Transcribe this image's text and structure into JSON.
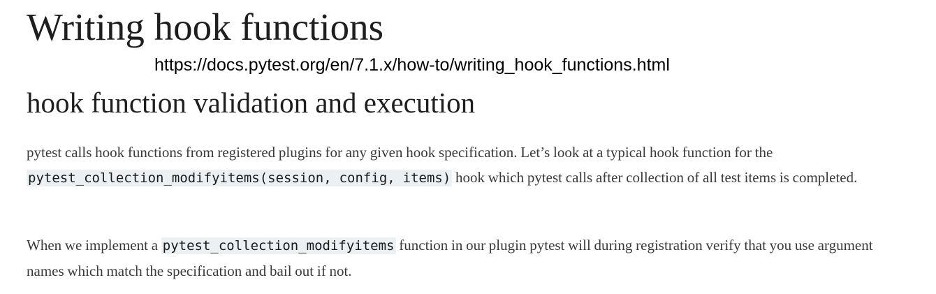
{
  "page": {
    "title": "Writing hook functions",
    "url_annotation": "https://docs.pytest.org/en/7.1.x/how-to/writing_hook_functions.html",
    "section_heading": "hook function validation and execution"
  },
  "paragraph_1": {
    "text_before": "pytest calls hook functions from registered plugins for any given hook specification. Let’s look at a typical hook function for the ",
    "code": "pytest_collection_modifyitems(session, config, items)",
    "text_after": " hook which pytest calls after collection of all test items is completed."
  },
  "paragraph_2": {
    "text_before": "When we implement a ",
    "code": "pytest_collection_modifyitems",
    "text_after": " function in our plugin pytest will during registration verify that you use argument names which match the specification and bail out if not."
  },
  "colors": {
    "code_background": "#ecf0f3",
    "body_text": "#3a3a3a",
    "heading_text": "#1e1e1e"
  }
}
